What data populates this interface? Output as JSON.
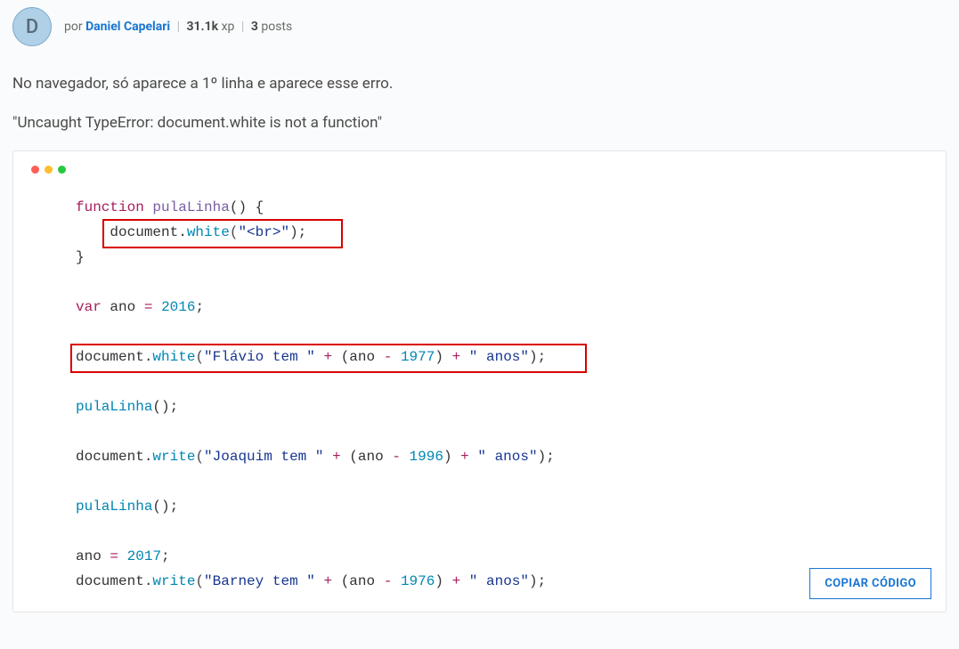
{
  "author": {
    "initial": "D",
    "by_label": "por",
    "name": "Daniel Capelari",
    "xp_value": "31.1k",
    "xp_label": "xp",
    "posts_count": "3",
    "posts_label": "posts"
  },
  "body": {
    "p1": "No navegador, só aparece a 1º linha e aparece esse erro.",
    "p2": "\"Uncaught TypeError: document.white is not a function\""
  },
  "code": {
    "l1_kw": "function",
    "l1_fn": "pulaLinha",
    "l1_rest": "() {",
    "l2_obj": "document",
    "l2_dot": ".",
    "l2_call": "white",
    "l2_str": "\"<br>\"",
    "l2_end": ");",
    "l3": "}",
    "l4_kw": "var",
    "l4_name": "ano",
    "l4_eq": "=",
    "l4_val": "2016",
    "l4_end": ";",
    "l5_obj": "document",
    "l5_dot": ".",
    "l5_call": "white",
    "l5_str1": "\"Flávio tem \"",
    "l5_plus1": "+",
    "l5_lp": "(ano",
    "l5_minus": "-",
    "l5_num": "1977",
    "l5_rp": ")",
    "l5_plus2": "+",
    "l5_str2": "\" anos\"",
    "l5_end": ");",
    "l6_fn": "pulaLinha",
    "l6_end": "();",
    "l7_obj": "document",
    "l7_dot": ".",
    "l7_call": "write",
    "l7_str1": "\"Joaquim tem \"",
    "l7_plus1": "+",
    "l7_lp": "(ano",
    "l7_minus": "-",
    "l7_num": "1996",
    "l7_rp": ")",
    "l7_plus2": "+",
    "l7_str2": "\" anos\"",
    "l7_end": ");",
    "l8_fn": "pulaLinha",
    "l8_end": "();",
    "l9_name": "ano",
    "l9_eq": "=",
    "l9_val": "2017",
    "l9_end": ";",
    "l10_obj": "document",
    "l10_dot": ".",
    "l10_call": "write",
    "l10_str1": "\"Barney tem \"",
    "l10_plus1": "+",
    "l10_lp": "(ano",
    "l10_minus": "-",
    "l10_num": "1976",
    "l10_rp": ")",
    "l10_plus2": "+",
    "l10_str2": "\" anos\"",
    "l10_end": ");"
  },
  "copy_button_label": "COPIAR CÓDIGO"
}
